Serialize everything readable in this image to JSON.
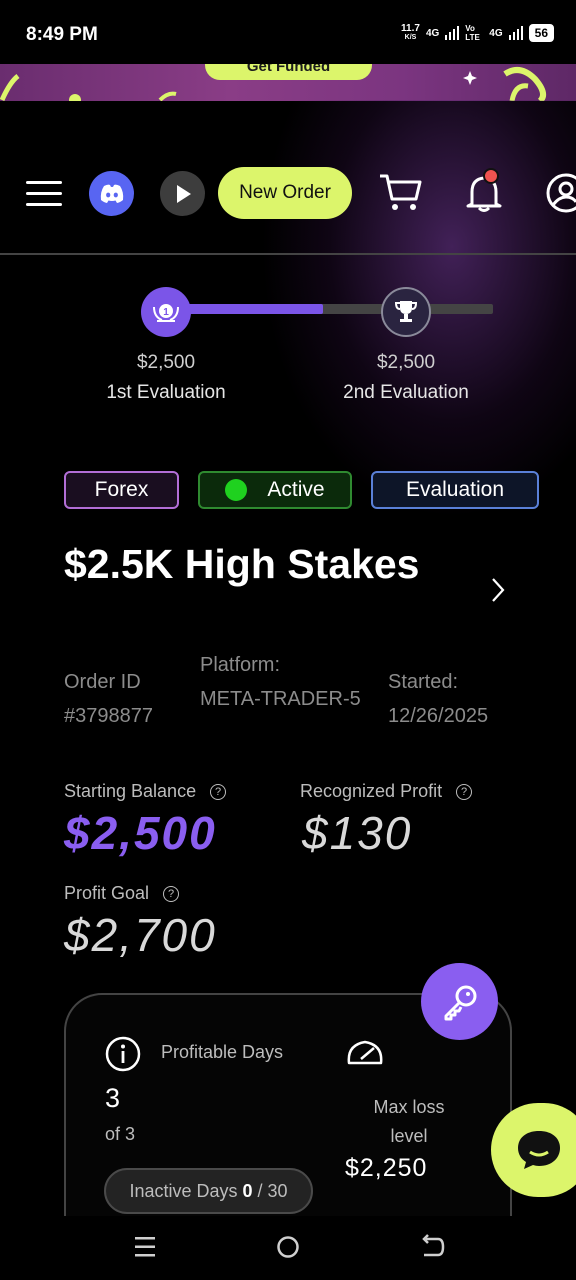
{
  "status_bar": {
    "time": "8:49 PM",
    "net_speed": "11.7",
    "net_unit": "K/S",
    "sig1": "4G",
    "volte": "Vo LTE",
    "sig2": "4G",
    "battery": "56"
  },
  "banner": {
    "button_label": "Get Funded"
  },
  "header": {
    "new_order_label": "New Order"
  },
  "progress": {
    "fraction": 0.48,
    "steps": [
      {
        "amount": "$2,500",
        "label": "1st Evaluation"
      },
      {
        "amount": "$2,500",
        "label": "2nd Evaluation"
      }
    ]
  },
  "badges": {
    "forex": "Forex",
    "active": "Active",
    "evaluation": "Evaluation"
  },
  "account": {
    "title": "$2.5K High Stakes",
    "order_id_label": "Order ID",
    "order_id": "#3798877",
    "platform_label": "Platform:",
    "platform": "META-TRADER-5",
    "started_label": "Started:",
    "started": "12/26/2025"
  },
  "stats": {
    "starting_balance_label": "Starting Balance",
    "starting_balance": "$2,500",
    "recognized_profit_label": "Recognized Profit",
    "recognized_profit": "$130",
    "profit_goal_label": "Profit Goal",
    "profit_goal": "$2,700",
    "help_glyph": "?"
  },
  "card": {
    "profitable_days_label": "Profitable Days",
    "profitable_days_value": "3",
    "profitable_days_of": "of 3",
    "max_loss_label": "Max loss level",
    "max_loss_value": "$2,250",
    "inactive_label": "Inactive Days",
    "inactive_value": "0",
    "inactive_total": "/ 30"
  },
  "colors": {
    "accent_purple": "#8a5ef0",
    "accent_lime": "#dcf56b",
    "active_green": "#1fd11f"
  }
}
